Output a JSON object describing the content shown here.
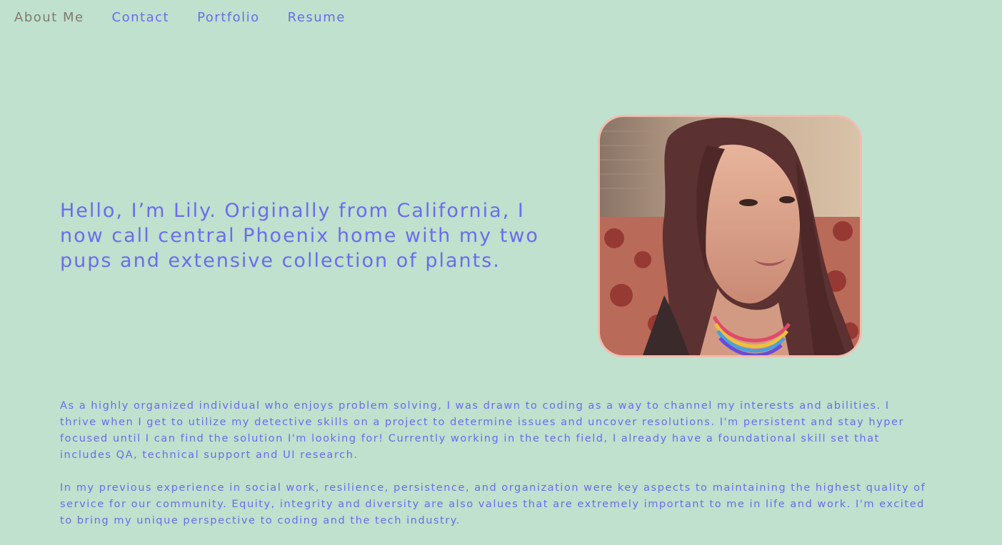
{
  "nav": {
    "items": [
      {
        "label": "About Me",
        "active": true
      },
      {
        "label": "Contact",
        "active": false
      },
      {
        "label": "Portfolio",
        "active": false
      },
      {
        "label": "Resume",
        "active": false
      }
    ]
  },
  "hero": {
    "intro": "Hello, I’m Lily. Originally from California, I now call central Phoenix home with my two pups and extensive collection of plants."
  },
  "about": {
    "paragraphs": [
      "As a highly organized individual who enjoys problem solving, I was drawn to coding as a way to channel my interests and abilities. I thrive when I get to utilize my detective skills on a project to determine issues and uncover resolutions. I'm persistent and stay hyper focused until I can find the solution I'm looking for! Currently working in the tech field, I already have a foundational skill set that includes QA, technical support and UI research.",
      "In my previous experience in social work, resilience, persistence, and organization were key aspects to maintaining the highest quality of service for our community. Equity, integrity and diversity are also values that are extremely important to me in life and work. I'm excited to bring my unique perspective to coding and the tech industry."
    ]
  },
  "colors": {
    "background": "#bfe1cd",
    "link": "#6a6cf0",
    "active_link": "#807a72",
    "photo_border": "#f2bcae"
  }
}
